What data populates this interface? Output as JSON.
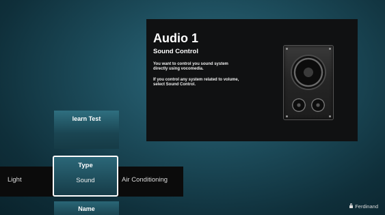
{
  "info_panel": {
    "title": "Audio 1",
    "subtitle": "Sound Control",
    "paragraph_1": "You want to control you sound system directly using vocomedia.",
    "paragraph_2": "If you control any system related to volume, select Sound Control.",
    "icon": "speaker-icon"
  },
  "menu": {
    "learn_label": "learn Test",
    "type_label": "Type",
    "type_selected": "Sound",
    "type_options": [
      "Light",
      "Sound",
      "Air Conditioning"
    ],
    "name_label": "Name"
  },
  "status": {
    "user": "Ferdinand",
    "user_icon": "lock-icon"
  }
}
